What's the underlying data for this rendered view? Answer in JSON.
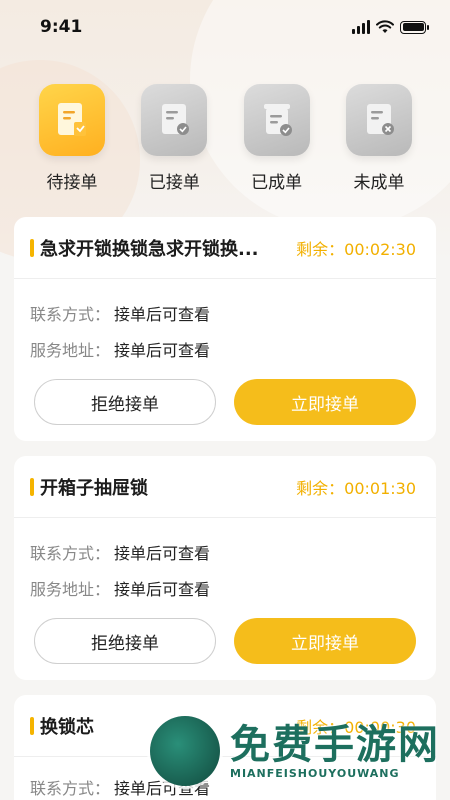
{
  "status_bar": {
    "time": "9:41"
  },
  "tabs": [
    {
      "label": "待接单",
      "icon": "doc-pending-icon",
      "active": true
    },
    {
      "label": "已接单",
      "icon": "doc-accepted-icon",
      "active": false
    },
    {
      "label": "已成单",
      "icon": "doc-completed-icon",
      "active": false
    },
    {
      "label": "未成单",
      "icon": "doc-failed-icon",
      "active": false
    }
  ],
  "orders": [
    {
      "title": "急求开锁换锁急求开锁换...",
      "remain_label": "剩余：",
      "remain_time": "00:02:30",
      "contact_label": "联系方式：",
      "contact_value": "接单后可查看",
      "address_label": "服务地址：",
      "address_value": "接单后可查看",
      "reject_label": "拒绝接单",
      "accept_label": "立即接单"
    },
    {
      "title": "开箱子抽屉锁",
      "remain_label": "剩余：",
      "remain_time": "00:01:30",
      "contact_label": "联系方式：",
      "contact_value": "接单后可查看",
      "address_label": "服务地址：",
      "address_value": "接单后可查看",
      "reject_label": "拒绝接单",
      "accept_label": "立即接单"
    },
    {
      "title": "换锁芯",
      "remain_label": "剩余：",
      "remain_time": "00:00:30",
      "contact_label": "联系方式：",
      "contact_value": "接单后可查看"
    }
  ],
  "watermark": {
    "cn": "免费手游网",
    "en": "MIANFEISHOUYOUWANG"
  },
  "colors": {
    "accent": "#f5bd1b",
    "remain": "#f2b000",
    "tab_active": "#ffb020",
    "tab_inactive": "#c8c8c8"
  }
}
